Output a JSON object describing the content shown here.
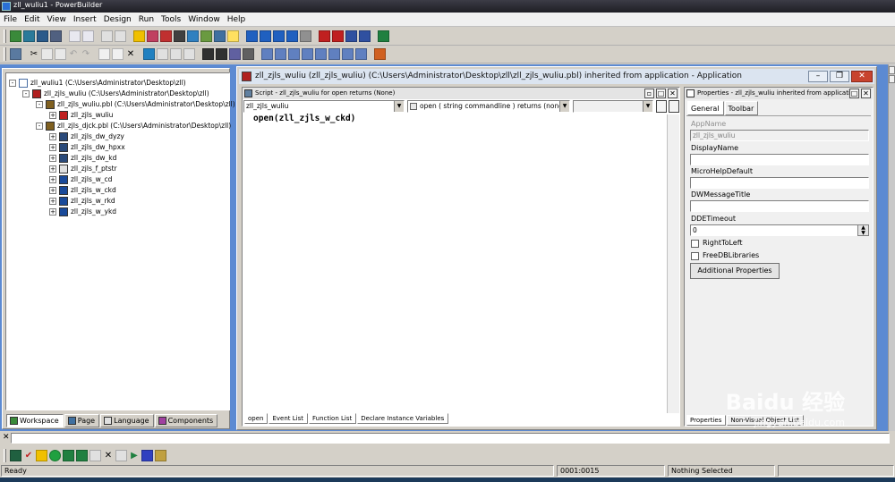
{
  "window": {
    "title": "zll_wuliu1 - PowerBuilder"
  },
  "menu": [
    "File",
    "Edit",
    "View",
    "Insert",
    "Design",
    "Run",
    "Tools",
    "Window",
    "Help"
  ],
  "workspace": {
    "tree": [
      {
        "label": "zll_wuliu1 (C:\\Users\\Administrator\\Desktop\\zll)",
        "level": 0,
        "icon": "workspace-icon",
        "expander": "-"
      },
      {
        "label": "zll_zjls_wuliu (C:\\Users\\Administrator\\Desktop\\zll)",
        "level": 1,
        "icon": "target-icon",
        "expander": "-"
      },
      {
        "label": "zll_zjls_wuliu.pbl (C:\\Users\\Administrator\\Desktop\\zll)",
        "level": 2,
        "icon": "library-icon",
        "expander": "-"
      },
      {
        "label": "zll_zjls_wuliu",
        "level": 3,
        "icon": "application-icon",
        "expander": "+"
      },
      {
        "label": "zll_zjls_djck.pbl (C:\\Users\\Administrator\\Desktop\\zll)",
        "level": 2,
        "icon": "library-icon",
        "expander": "-"
      },
      {
        "label": "zll_zjls_dw_dyzy",
        "level": 3,
        "icon": "datawindow-icon",
        "expander": "+"
      },
      {
        "label": "zll_zjls_dw_hpxx",
        "level": 3,
        "icon": "datawindow-icon",
        "expander": "+"
      },
      {
        "label": "zll_zjls_dw_kd",
        "level": 3,
        "icon": "datawindow-icon",
        "expander": "+"
      },
      {
        "label": "zll_zjls_f_ptstr",
        "level": 3,
        "icon": "function-icon",
        "expander": "+"
      },
      {
        "label": "zll_zjls_w_cd",
        "level": 3,
        "icon": "window-icon",
        "expander": "+"
      },
      {
        "label": "zll_zjls_w_ckd",
        "level": 3,
        "icon": "window-icon",
        "expander": "+"
      },
      {
        "label": "zll_zjls_w_rkd",
        "level": 3,
        "icon": "window-icon",
        "expander": "+"
      },
      {
        "label": "zll_zjls_w_ykd",
        "level": 3,
        "icon": "window-icon",
        "expander": "+"
      }
    ],
    "tabs": [
      "Workspace",
      "Page",
      "Language",
      "Components"
    ]
  },
  "app_window": {
    "title": "zll_zjls_wuliu (zll_zjls_wuliu) (C:\\Users\\Administrator\\Desktop\\zll\\zll_zjls_wuliu.pbl) inherited from application - Application"
  },
  "script": {
    "title": "Script - zll_zjls_wuliu for open returns (None)",
    "object": "zll_zjls_wuliu",
    "event": "open ( string commandline ) returns (none)",
    "code": "open(zll_zjls_w_ckd)",
    "tabs": [
      "open",
      "Event List",
      "Function List",
      "Declare Instance Variables"
    ]
  },
  "properties": {
    "title": "Properties - zll_zjls_wuliu inherited from application",
    "tabs": [
      "General",
      "Toolbar"
    ],
    "fields": [
      {
        "label": "AppName",
        "value": "zll_zjls_wuliu",
        "disabled": true
      },
      {
        "label": "DisplayName",
        "value": ""
      },
      {
        "label": "MicroHelpDefault",
        "value": ""
      },
      {
        "label": "DWMessageTitle",
        "value": ""
      },
      {
        "label": "DDETimeout",
        "value": "0"
      }
    ],
    "checkboxes": [
      "RightToLeft",
      "FreeDBLibraries"
    ],
    "button": "Additional Properties",
    "bottom_tabs": [
      "Properties",
      "Non-Visual Object List"
    ]
  },
  "status": {
    "message": "Ready",
    "position": "0001:0015",
    "selection": "Nothing Selected"
  },
  "watermark": {
    "brand": "Baidu 经验",
    "url": "jingyan.baidu.com"
  },
  "colors": {
    "mdi_background": "#5c8ad2",
    "titlebar": "#2a2a32",
    "chrome": "#d4d0c8"
  }
}
